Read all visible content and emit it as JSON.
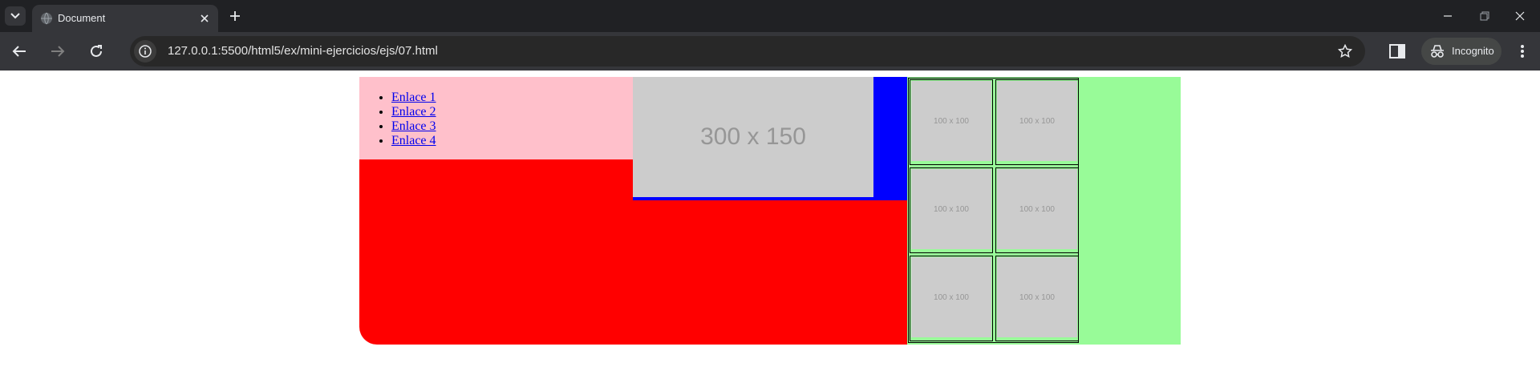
{
  "browser": {
    "tab": {
      "title": "Document"
    },
    "url": "127.0.0.1:5500/html5/ex/mini-ejercicios/ejs/07.html",
    "incognito_label": "Incognito"
  },
  "page": {
    "nav_links": [
      "Enlace 1",
      "Enlace 2",
      "Enlace 3",
      "Enlace 4"
    ],
    "main_image": "300 x 150",
    "gallery": [
      "100 x 100",
      "100 x 100",
      "100 x 100",
      "100 x 100",
      "100 x 100",
      "100 x 100"
    ],
    "colors": {
      "nav_bg": "#ffc0cb",
      "main_bg": "#ff0000",
      "image_frame": "#0000ff",
      "aside_bg": "#98fb98",
      "placeholder_bg": "#cccccc"
    }
  }
}
